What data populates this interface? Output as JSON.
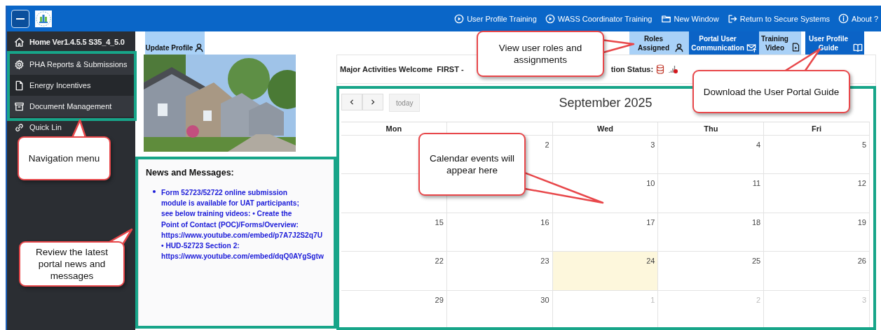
{
  "top_bar": {
    "links": [
      {
        "label": "User Profile Training",
        "kind": "play"
      },
      {
        "label": "WASS Coordinator Training",
        "kind": "play"
      },
      {
        "label": "New Window",
        "kind": "folder"
      },
      {
        "label": "Return to Secure Systems",
        "kind": "exit"
      },
      {
        "label": "About ?",
        "kind": "info"
      }
    ]
  },
  "sidebar": {
    "items": [
      {
        "label": "Home Ver1.4.5.5 S35_4_5.0",
        "kind": "home"
      },
      {
        "label": "PHA Reports & Submissions",
        "kind": "gear"
      },
      {
        "label": "Energy Incentives",
        "kind": "page"
      },
      {
        "label": "Document Management",
        "kind": "archive"
      },
      {
        "label": "Quick Lin",
        "kind": "link"
      }
    ]
  },
  "update_profile": {
    "label": "Update Profile",
    "kind": "light"
  },
  "news": {
    "title": "News and Messages:",
    "lines": [
      "Form 52723/52722 online submission",
      "module is available for UAT participants;",
      "see below training videos: • Create the",
      "Point of Contact (POC)/Forms/Overview:",
      "https://www.youtube.com/embed/p7A7J2S2q7U",
      "• HUD-52723 Section 2:",
      "https://www.youtube.com/embed/dqQ0AYgSgtw"
    ]
  },
  "action_buttons": [
    {
      "label": "Roles Assigned",
      "kind": "light"
    },
    {
      "label": "Portal User Communication",
      "kind": "dark"
    },
    {
      "label": "Training Video",
      "kind": "light"
    },
    {
      "label": "User Profile Guide",
      "kind": "dark"
    }
  ],
  "calendar": {
    "welcome": "Major Activities Welcome  FIRST -",
    "status": "tion Status:",
    "title": "September 2025",
    "today_button": "today",
    "columns": [
      {
        "label": "Mon"
      },
      {},
      {
        "label": "Wed"
      },
      {
        "label": "Thu"
      },
      {
        "label": "Fri"
      }
    ],
    "weeks": [
      {
        "days": [
          {
            "day": "2",
            "other_month": false,
            "today": false
          },
          {
            "day": "3",
            "other_month": false,
            "today": false
          },
          {
            "day": "4",
            "other_month": false,
            "today": false
          },
          {
            "day": "5",
            "other_month": false,
            "today": false
          }
        ]
      },
      {
        "days": [
          {
            "day": "10",
            "other_month": false,
            "today": false
          },
          {
            "day": "11",
            "other_month": false,
            "today": false
          },
          {
            "day": "12",
            "other_month": false,
            "today": false
          }
        ]
      },
      {
        "days": [
          {
            "day": "15",
            "other_month": false,
            "today": false
          },
          {
            "day": "16",
            "other_month": false,
            "today": false
          },
          {
            "day": "17",
            "other_month": false,
            "today": false
          },
          {
            "day": "18",
            "other_month": false,
            "today": false
          },
          {
            "day": "19",
            "other_month": false,
            "today": false
          }
        ]
      },
      {
        "days": [
          {
            "day": "22",
            "other_month": false,
            "today": false
          },
          {
            "day": "23",
            "other_month": false,
            "today": false
          },
          {
            "day": "24",
            "other_month": false,
            "today": true
          },
          {
            "day": "25",
            "other_month": false,
            "today": false
          },
          {
            "day": "26",
            "other_month": false,
            "today": false
          }
        ]
      },
      {
        "days": [
          {
            "day": "29",
            "other_month": false,
            "today": false
          },
          {
            "day": "30",
            "other_month": false,
            "today": false
          },
          {
            "day": "1",
            "other_month": true,
            "today": false
          },
          {
            "day": "2",
            "other_month": true,
            "today": false
          },
          {
            "day": "3",
            "other_month": true,
            "today": false
          }
        ]
      }
    ]
  },
  "callouts": [
    {
      "text": "Navigation menu"
    },
    {
      "text": "View user roles and assignments"
    },
    {
      "text": "Download the User Portal Guide"
    },
    {
      "text": "Calendar events will appear here"
    },
    {
      "text": "Review the latest portal news and messages"
    }
  ]
}
